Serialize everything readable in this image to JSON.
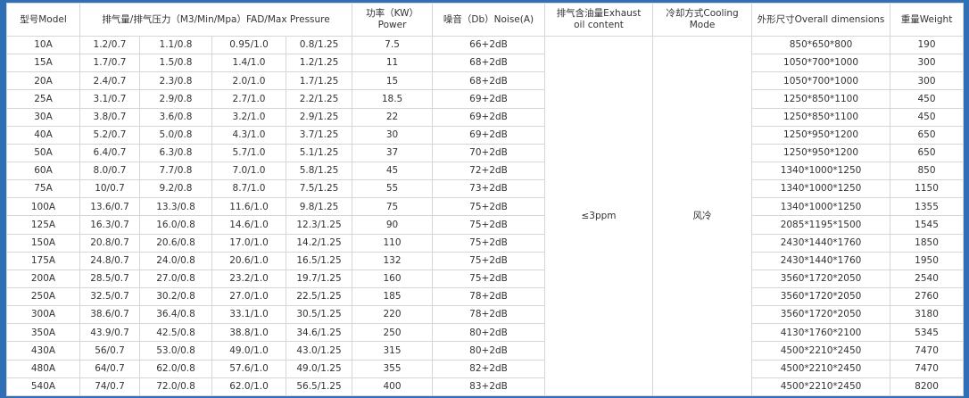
{
  "headers": {
    "model": "型号Model",
    "fad": "排气量/排气压力（M3/Min/Mpa）FAD/Max Pressure",
    "power_line1": "功率（KW）",
    "power_line2": "Power",
    "noise": "噪音（Db）Noise(A)",
    "oil_line1": "排气含油量Exhaust",
    "oil_line2": "oil content",
    "cooling_line1": "冷却方式Cooling",
    "cooling_line2": "Mode",
    "dimensions": "外形尺寸Overall dimensions",
    "weight": "重量Weight"
  },
  "oil_content": "≤3ppm",
  "cooling_mode": "风冷",
  "rows": [
    {
      "model": "10A",
      "p07": "1.2/0.7",
      "p08": "1.1/0.8",
      "p10": "0.95/1.0",
      "p125": "0.8/1.25",
      "power": "7.5",
      "noise": "66+2dB",
      "dims": "850*650*800",
      "weight": "190"
    },
    {
      "model": "15A",
      "p07": "1.7/0.7",
      "p08": "1.5/0.8",
      "p10": "1.4/1.0",
      "p125": "1.2/1.25",
      "power": "11",
      "noise": "68+2dB",
      "dims": "1050*700*1000",
      "weight": "300"
    },
    {
      "model": "20A",
      "p07": "2.4/0.7",
      "p08": "2.3/0.8",
      "p10": "2.0/1.0",
      "p125": "1.7/1.25",
      "power": "15",
      "noise": "68+2dB",
      "dims": "1050*700*1000",
      "weight": "300"
    },
    {
      "model": "25A",
      "p07": "3.1/0.7",
      "p08": "2.9/0.8",
      "p10": "2.7/1.0",
      "p125": "2.2/1.25",
      "power": "18.5",
      "noise": "69+2dB",
      "dims": "1250*850*1100",
      "weight": "450"
    },
    {
      "model": "30A",
      "p07": "3.8/0.7",
      "p08": "3.6/0.8",
      "p10": "3.2/1.0",
      "p125": "2.9/1.25",
      "power": "22",
      "noise": "69+2dB",
      "dims": "1250*850*1100",
      "weight": "450"
    },
    {
      "model": "40A",
      "p07": "5.2/0.7",
      "p08": "5.0/0.8",
      "p10": "4.3/1.0",
      "p125": "3.7/1.25",
      "power": "30",
      "noise": "69+2dB",
      "dims": "1250*950*1200",
      "weight": "650"
    },
    {
      "model": "50A",
      "p07": "6.4/0.7",
      "p08": "6.3/0.8",
      "p10": "5.7/1.0",
      "p125": "5.1/1.25",
      "power": "37",
      "noise": "70+2dB",
      "dims": "1250*950*1200",
      "weight": "650"
    },
    {
      "model": "60A",
      "p07": "8.0/0.7",
      "p08": "7.7/0.8",
      "p10": "7.0/1.0",
      "p125": "5.8/1.25",
      "power": "45",
      "noise": "72+2dB",
      "dims": "1340*1000*1250",
      "weight": "850"
    },
    {
      "model": "75A",
      "p07": "10/0.7",
      "p08": "9.2/0.8",
      "p10": "8.7/1.0",
      "p125": "7.5/1.25",
      "power": "55",
      "noise": "73+2dB",
      "dims": "1340*1000*1250",
      "weight": "1150"
    },
    {
      "model": "100A",
      "p07": "13.6/0.7",
      "p08": "13.3/0.8",
      "p10": "11.6/1.0",
      "p125": "9.8/1.25",
      "power": "75",
      "noise": "75+2dB",
      "dims": "1340*1000*1250",
      "weight": "1355"
    },
    {
      "model": "125A",
      "p07": "16.3/0.7",
      "p08": "16.0/0.8",
      "p10": "14.6/1.0",
      "p125": "12.3/1.25",
      "power": "90",
      "noise": "75+2dB",
      "dims": "2085*1195*1500",
      "weight": "1545"
    },
    {
      "model": "150A",
      "p07": "20.8/0.7",
      "p08": "20.6/0.8",
      "p10": "17.0/1.0",
      "p125": "14.2/1.25",
      "power": "110",
      "noise": "75+2dB",
      "dims": "2430*1440*1760",
      "weight": "1850"
    },
    {
      "model": "175A",
      "p07": "24.8/0.7",
      "p08": "24.0/0.8",
      "p10": "20.6/1.0",
      "p125": "16.5/1.25",
      "power": "132",
      "noise": "75+2dB",
      "dims": "2430*1440*1760",
      "weight": "1950"
    },
    {
      "model": "200A",
      "p07": "28.5/0.7",
      "p08": "27.0/0.8",
      "p10": "23.2/1.0",
      "p125": "19.7/1.25",
      "power": "160",
      "noise": "75+2dB",
      "dims": "3560*1720*2050",
      "weight": "2540"
    },
    {
      "model": "250A",
      "p07": "32.5/0.7",
      "p08": "30.2/0.8",
      "p10": "27.0/1.0",
      "p125": "22.5/1.25",
      "power": "185",
      "noise": "78+2dB",
      "dims": "3560*1720*2050",
      "weight": "2760"
    },
    {
      "model": "300A",
      "p07": "38.6/0.7",
      "p08": "36.4/0.8",
      "p10": "33.1/1.0",
      "p125": "30.5/1.25",
      "power": "220",
      "noise": "78+2dB",
      "dims": "3560*1720*2050",
      "weight": "3180"
    },
    {
      "model": "350A",
      "p07": "43.9/0.7",
      "p08": "42.5/0.8",
      "p10": "38.8/1.0",
      "p125": "34.6/1.25",
      "power": "250",
      "noise": "80+2dB",
      "dims": "4130*1760*2100",
      "weight": "5345"
    },
    {
      "model": "430A",
      "p07": "56/0.7",
      "p08": "53.0/0.8",
      "p10": "49.0/1.0",
      "p125": "43.0/1.25",
      "power": "315",
      "noise": "80+2dB",
      "dims": "4500*2210*2450",
      "weight": "7470"
    },
    {
      "model": "480A",
      "p07": "64/0.7",
      "p08": "62.0/0.8",
      "p10": "57.6/1.0",
      "p125": "49.0/1.25",
      "power": "355",
      "noise": "82+2dB",
      "dims": "4500*2210*2450",
      "weight": "7470"
    },
    {
      "model": "540A",
      "p07": "74/0.7",
      "p08": "72.0/0.8",
      "p10": "62.0/1.0",
      "p125": "56.5/1.25",
      "power": "400",
      "noise": "83+2dB",
      "dims": "4500*2210*2450",
      "weight": "8200"
    }
  ],
  "colors": {
    "border": "#d6d6d6",
    "text": "#333333",
    "page_background": "#2f6fb6",
    "table_background": "#ffffff"
  }
}
